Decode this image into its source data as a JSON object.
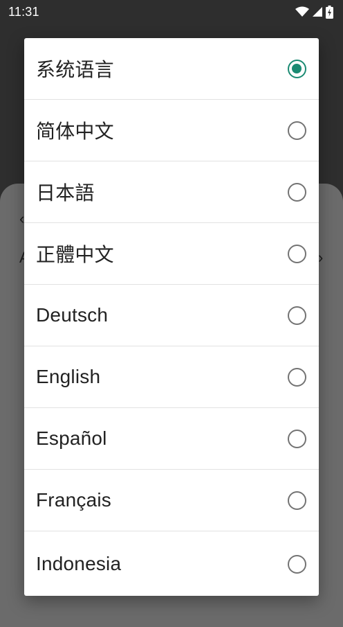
{
  "status_bar": {
    "time": "11:31",
    "icons": [
      "wifi-icon",
      "signal-icon",
      "battery-charging-icon"
    ]
  },
  "dialog": {
    "selected_index": 0,
    "accent_color": "#1a8a72",
    "options": [
      {
        "label": "系统语言",
        "checked": true
      },
      {
        "label": "简体中文",
        "checked": false
      },
      {
        "label": "日本語",
        "checked": false
      },
      {
        "label": "正體中文",
        "checked": false
      },
      {
        "label": "Deutsch",
        "checked": false
      },
      {
        "label": "English",
        "checked": false
      },
      {
        "label": "Español",
        "checked": false
      },
      {
        "label": "Français",
        "checked": false
      },
      {
        "label": "Indonesia",
        "checked": false
      }
    ]
  }
}
